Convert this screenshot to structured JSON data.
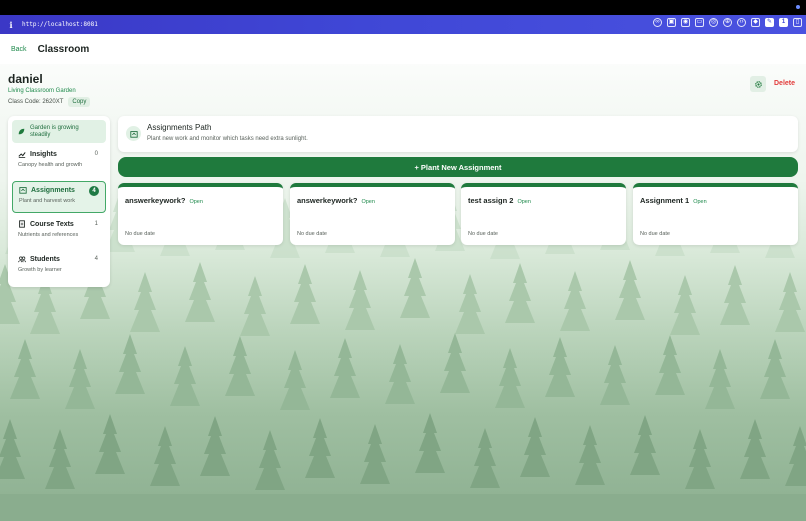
{
  "browser": {
    "url": "http://localhost:8081"
  },
  "header": {
    "back_label": "Back",
    "title": "Classroom"
  },
  "classroom": {
    "name": "daniel",
    "subtitle": "Living Classroom Garden",
    "class_code": "Class Code: 2620XT",
    "copy_label": "Copy",
    "delete_label": "Delete"
  },
  "sidebar": {
    "status_text": "Garden is growing steadily",
    "items": [
      {
        "label": "Insights",
        "desc": "Canopy health and growth",
        "count": "0"
      },
      {
        "label": "Assignments",
        "desc": "Plant and harvest work",
        "count": "4"
      },
      {
        "label": "Course Texts",
        "desc": "Nutrients and references",
        "count": "1"
      },
      {
        "label": "Students",
        "desc": "Growth by learner",
        "count": "4"
      }
    ]
  },
  "path": {
    "title": "Assignments Path",
    "description": "Plant new work and monitor which tasks need extra sunlight."
  },
  "plant_button": "+ Plant New Assignment",
  "assignments": [
    {
      "title": "answerkeywork?",
      "status": "Open",
      "due": "No due date"
    },
    {
      "title": "answerkeywork?",
      "status": "Open",
      "due": "No due date"
    },
    {
      "title": "test assign 2",
      "status": "Open",
      "due": "No due date"
    },
    {
      "title": "Assignment 1",
      "status": "Open",
      "due": "No due date"
    }
  ],
  "colors": {
    "accent": "#1f7a3d",
    "danger": "#e23b3b",
    "browser_bar": "#3f47d6"
  }
}
